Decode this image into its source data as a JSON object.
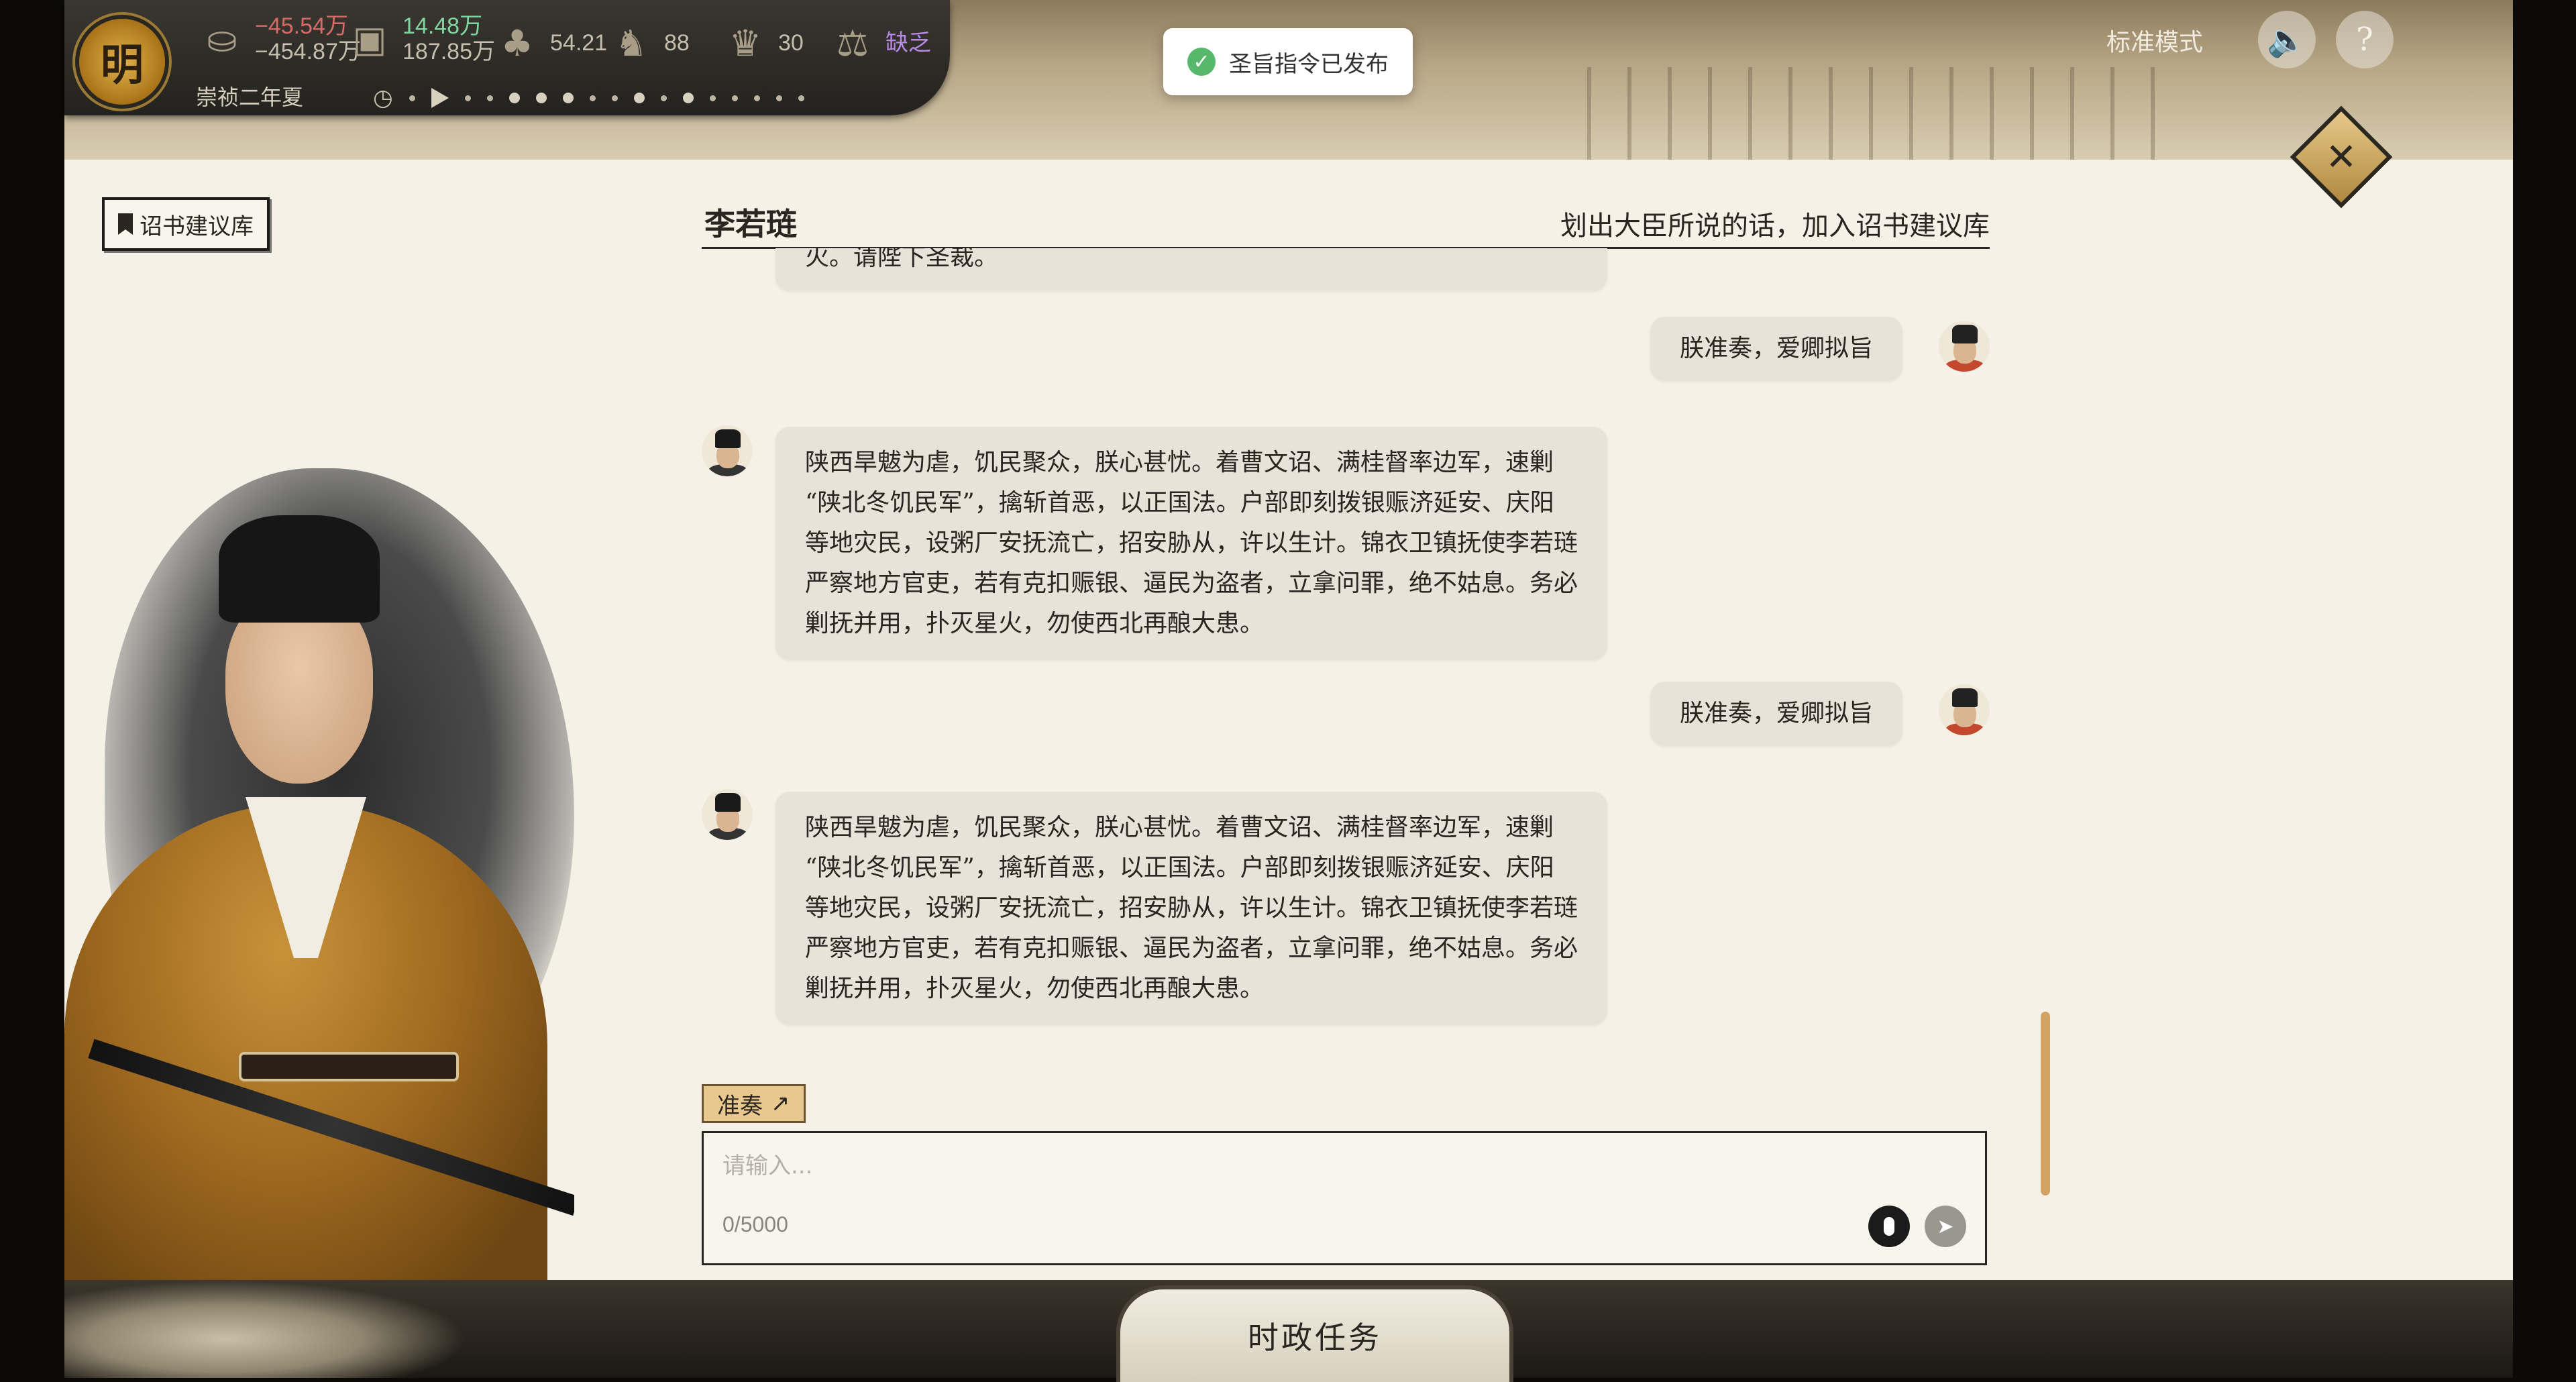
{
  "status": {
    "dynasty": "明",
    "silver_delta": "−45.54万",
    "silver_total": "−454.87万",
    "grain_delta": "14.48万",
    "grain_total": "187.85万",
    "stat_a": "54.21",
    "stat_b": "88",
    "stat_c": "30",
    "stat_d": "缺乏",
    "era": "崇祯二年夏"
  },
  "top_right": {
    "mode": "标准模式",
    "sound_icon": "speaker-icon",
    "help_label": "?"
  },
  "toast": {
    "text": "圣旨指令已发布",
    "icon": "check-icon"
  },
  "panel": {
    "library_button": "诏书建议库",
    "close_label": "✕"
  },
  "chat": {
    "minister_name": "李若琏",
    "hint": "划出大臣所说的话，加入诏书建议库",
    "top_partial": "火。请陛下圣裁。",
    "messages": [
      {
        "role": "emperor",
        "text": "朕准奏，爱卿拟旨"
      },
      {
        "role": "minister",
        "lines": [
          "陕西旱魃为虐，饥民聚众，朕心甚忧。着曹文诏、满桂督率边军，速剿",
          "“陕北冬饥民军”，擒斩首恶，以正国法。户部即刻拨银赈济延安、庆阳",
          "等地灾民，设粥厂安抚流亡，招安胁从，许以生计。锦衣卫镇抚使李若琏",
          "严察地方官吏，若有克扣赈银、逼民为盗者，立拿问罪，绝不姑息。务必",
          "剿抚并用，扑灭星火，勿使西北再酿大患。"
        ]
      },
      {
        "role": "emperor",
        "text": "朕准奏，爱卿拟旨"
      },
      {
        "role": "minister",
        "lines": [
          "陕西旱魃为虐，饥民聚众，朕心甚忧。着曹文诏、满桂督率边军，速剿",
          "“陕北冬饥民军”，擒斩首恶，以正国法。户部即刻拨银赈济延安、庆阳",
          "等地灾民，设粥厂安抚流亡，招安胁从，许以生计。锦衣卫镇抚使李若琏",
          "严察地方官吏，若有克扣赈银、逼民为盗者，立拿问罪，绝不姑息。务必",
          "剿抚并用，扑灭星火，勿使西北再酿大患。"
        ]
      }
    ],
    "approve_button": "准奏",
    "input_placeholder": "请输入...",
    "char_count": "0/5000"
  },
  "bottom": {
    "task_tab": "时政任务"
  }
}
